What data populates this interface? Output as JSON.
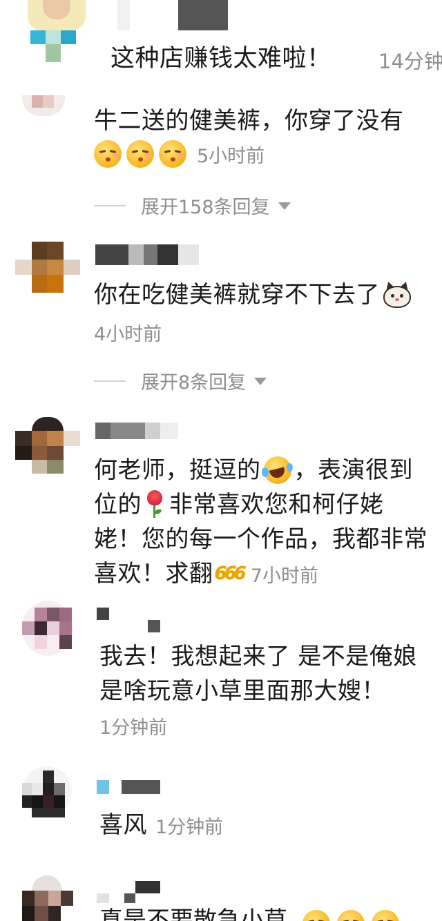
{
  "comments": [
    {
      "text": "这种店赚钱太难啦！",
      "time": "14分钟"
    },
    {
      "text": "牛二送的健美裤，你穿了没有",
      "time": "5小时前",
      "expand": "展开158条回复",
      "emojis": [
        "kissing-face-icon",
        "kissing-face-icon",
        "kissing-face-icon"
      ]
    },
    {
      "text": "你在吃健美裤就穿不下去了",
      "time": "4小时前",
      "expand": "展开8条回复",
      "emojis": [
        "cat-face-icon"
      ]
    },
    {
      "line1a": "何老师，挺逗的",
      "line1b": "，表演很到",
      "line2a": "位的",
      "line2b": "非常喜欢您和柯仔姥",
      "line3": "姥！您的每一个作品，我都非常",
      "line4": "喜欢！求翻",
      "time": "7小时前",
      "emojis": [
        "laughing-tears-icon",
        "rose-icon",
        "666-icon"
      ]
    },
    {
      "line1": "我去！我想起来了 是不是俺娘",
      "line2": "是啥玩意小草里面那大嫂！",
      "time": "1分钟前"
    },
    {
      "text": "喜风",
      "time": "1分钟前"
    },
    {
      "partial": "真是不要散急小草"
    }
  ],
  "icon_text": {
    "six": "666"
  },
  "colors": {
    "text": "#1a1a1a",
    "meta": "#8e8e8e",
    "background": "#ffffff"
  }
}
